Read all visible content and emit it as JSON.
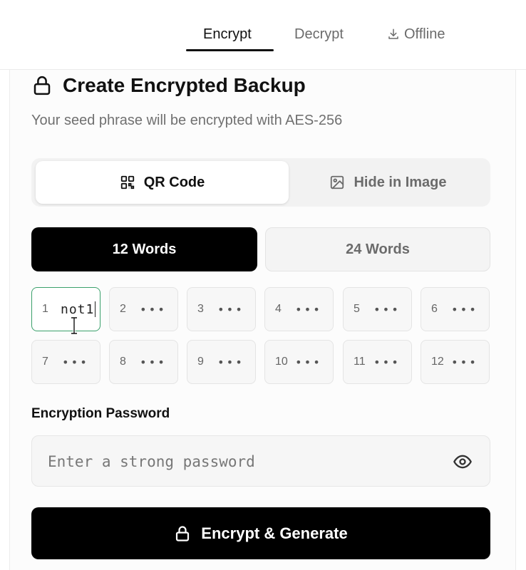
{
  "nav": {
    "tabs": [
      {
        "label": "Encrypt",
        "active": true
      },
      {
        "label": "Decrypt",
        "active": false
      },
      {
        "label": "Offline",
        "active": false,
        "icon": "download-icon"
      }
    ]
  },
  "card": {
    "title": "Create Encrypted Backup",
    "title_icon": "lock-icon",
    "subtitle": "Your seed phrase will be encrypted with AES-256"
  },
  "mode": {
    "options": [
      {
        "label": "QR Code",
        "icon": "qr-code-icon",
        "selected": true
      },
      {
        "label": "Hide in Image",
        "icon": "image-icon",
        "selected": false
      }
    ]
  },
  "word_count": {
    "options": [
      {
        "label": "12 Words",
        "selected": true
      },
      {
        "label": "24 Words",
        "selected": false
      }
    ]
  },
  "words": [
    {
      "num": "1",
      "value": "not1",
      "focused": true
    },
    {
      "num": "2",
      "value": "•••"
    },
    {
      "num": "3",
      "value": "•••"
    },
    {
      "num": "4",
      "value": "•••"
    },
    {
      "num": "5",
      "value": "•••"
    },
    {
      "num": "6",
      "value": "•••"
    },
    {
      "num": "7",
      "value": "•••"
    },
    {
      "num": "8",
      "value": "•••"
    },
    {
      "num": "9",
      "value": "•••"
    },
    {
      "num": "10",
      "value": "•••"
    },
    {
      "num": "11",
      "value": "•••"
    },
    {
      "num": "12",
      "value": "•••"
    }
  ],
  "password": {
    "label": "Encryption Password",
    "placeholder": "Enter a strong password",
    "value": "",
    "toggle_icon": "eye-icon"
  },
  "submit": {
    "label": "Encrypt & Generate",
    "icon": "lock-icon"
  },
  "colors": {
    "focus_border": "#3aa06b",
    "primary": "#000000"
  }
}
